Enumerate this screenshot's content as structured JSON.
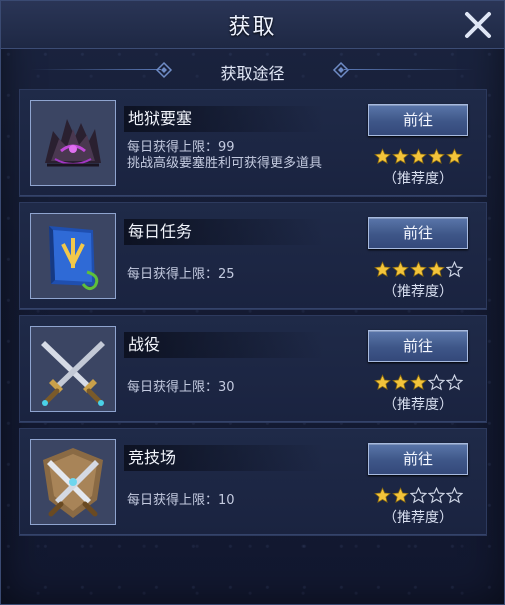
{
  "title": "获取",
  "subtitle": "获取途径",
  "colors": {
    "star_filled": "#f3c43b",
    "star_empty": "#cfd6e6",
    "button_top": "#5a76aa",
    "panel_bg": "#161e38"
  },
  "sources": [
    {
      "name": "地狱要塞",
      "limit": "每日获得上限：99",
      "desc": "挑战高级要塞胜利可获得更多道具",
      "button": "前往",
      "rating": 5,
      "recommend_label": "（推荐度）",
      "icon": "hell-fortress-icon"
    },
    {
      "name": "每日任务",
      "limit": "每日获得上限：25",
      "button": "前往",
      "rating": 4,
      "recommend_label": "（推荐度）",
      "icon": "quest-book-icon"
    },
    {
      "name": "战役",
      "limit": "每日获得上限：30",
      "button": "前往",
      "rating": 3,
      "recommend_label": "（推荐度）",
      "icon": "crossed-swords-icon"
    },
    {
      "name": "竞技场",
      "limit": "每日获得上限：10",
      "button": "前往",
      "rating": 2,
      "recommend_label": "（推荐度）",
      "icon": "arena-shield-icon"
    }
  ]
}
